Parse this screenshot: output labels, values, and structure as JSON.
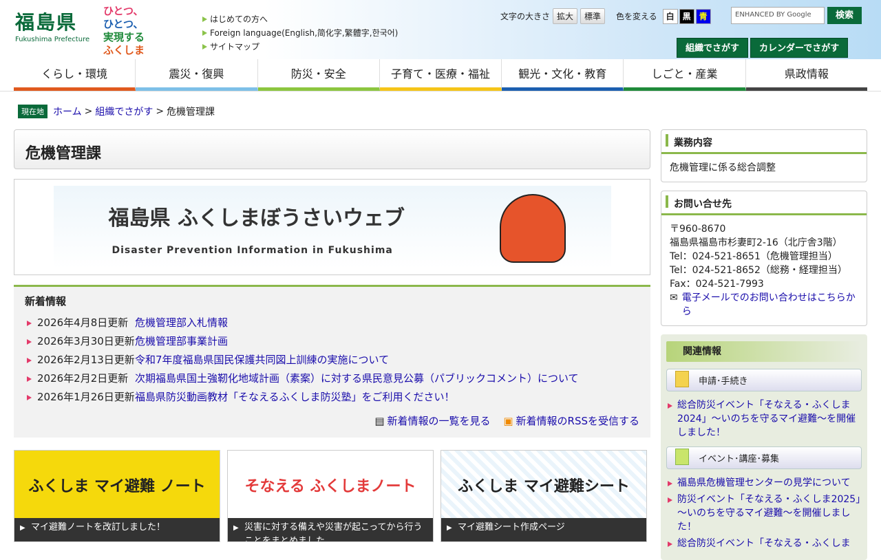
{
  "header": {
    "logo_kanji": "福島県",
    "logo_roman": "Fukushima Prefecture",
    "slogan": [
      "ひとつ、",
      "ひとつ、",
      "実現する",
      "ふくしま"
    ],
    "top_links": [
      "はじめての方へ",
      "Foreign language(English,简化字,繁體字,한국어)",
      "サイトマップ"
    ],
    "font_size_label": "文字の大きさ",
    "font_enlarge": "拡大",
    "font_standard": "標準",
    "color_label": "色を変える",
    "color_white": "白",
    "color_black": "黒",
    "color_blue": "青",
    "search_placeholder": "ENHANCED BY Google",
    "search_button": "検索",
    "org_button": "組織でさがす",
    "calendar_button": "カレンダーでさがす"
  },
  "nav": [
    {
      "label": "くらし・環境",
      "color": "#e05a1e"
    },
    {
      "label": "震災・復興",
      "color": "#7ec0e8"
    },
    {
      "label": "防災・安全",
      "color": "#8cc63f"
    },
    {
      "label": "子育て・医療・福祉",
      "color": "#f5c518"
    },
    {
      "label": "観光・文化・教育",
      "color": "#1c5fb0"
    },
    {
      "label": "しごと・産業",
      "color": "#1f8a3a"
    },
    {
      "label": "県政情報",
      "color": "#444444"
    }
  ],
  "breadcrumb": {
    "badge": "現在地",
    "home": "ホーム",
    "sep": ">",
    "org": "組織でさがす",
    "current": "危機管理課"
  },
  "page_title": "危機管理課",
  "banner": {
    "title": "福島県 ふくしまぼうさいウェブ",
    "subtitle": "Disaster Prevention Information in Fukushima"
  },
  "news": {
    "heading": "新着情報",
    "items": [
      {
        "date": "2026年4月8日更新",
        "title": "危機管理部入札情報"
      },
      {
        "date": "2026年3月30日更新",
        "title": "危機管理部事業計画"
      },
      {
        "date": "2026年2月13日更新",
        "title": "令和7年度福島県国民保護共同図上訓練の実施について"
      },
      {
        "date": "2026年2月2日更新",
        "title": "次期福島県国土強靭化地域計画（素案）に対する県民意見公募（パブリックコメント）について"
      },
      {
        "date": "2026年1月26日更新",
        "title": "福島県防災動画教材「そなえるふくしま防災塾」をご利用ください！"
      }
    ],
    "list_link": "新着情報の一覧を見る",
    "rss_link": "新着情報のRSSを受信する"
  },
  "cards": [
    {
      "image_text": "ふくしま マイ避難 ノート",
      "caption": "マイ避難ノートを改訂しました！",
      "bg": "#f5d90c"
    },
    {
      "image_text": "そなえる ふくしまノート",
      "caption": "災害に対する備えや災害が起こってから行うことをまとめました",
      "bg": "#ffffff"
    },
    {
      "image_text": "ふくしま マイ避難シート",
      "caption": "マイ避難シート作成ページ",
      "bg": "#ffffff"
    }
  ],
  "side": {
    "duty_heading": "業務内容",
    "duty_text": "危機管理に係る総合調整",
    "contact_heading": "お問い合せ先",
    "contact_lines": [
      "〒960-8670",
      "福島県福島市杉妻町2-16（北庁舎3階）",
      "Tel：024-521-8651（危機管理担当）",
      "Tel：024-521-8652（総務・経理担当）",
      "Fax：024-521-7993"
    ],
    "mail_link": "電子メールでのお問い合わせはこちらから",
    "related_heading": "関連情報",
    "sub1": "申請･手続き",
    "sub1_links": [
      "総合防災イベント「そなえる・ふくしま2024」～いのちを守るマイ避難～を開催しました！"
    ],
    "sub2": "イベント･講座･募集",
    "sub2_links": [
      "福島県危機管理センターの見学について",
      "防災イベント「そなえる・ふくしま2025」～いのちを守るマイ避難～を開催しました！",
      "総合防災イベント「そなえる・ふくしま"
    ]
  }
}
